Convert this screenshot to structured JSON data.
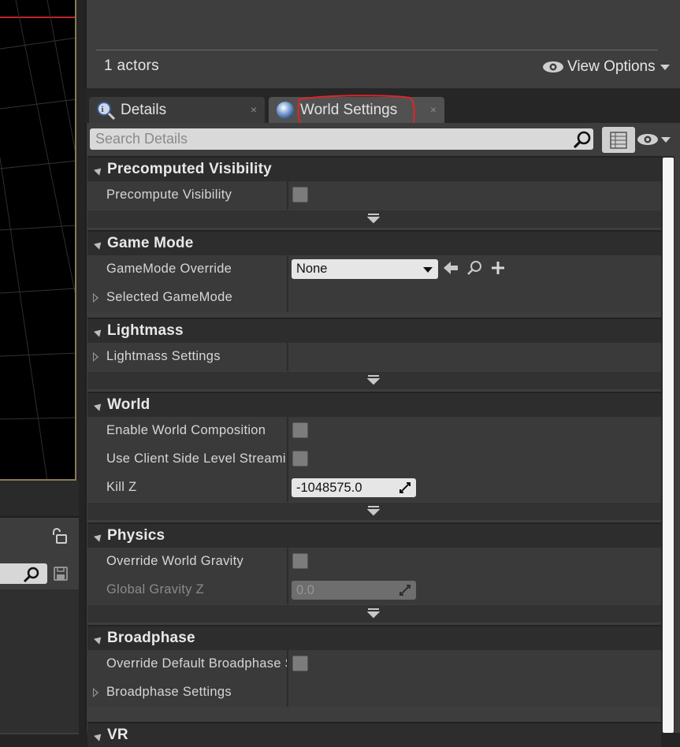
{
  "outliner": {
    "actors_count": "1 actors",
    "view_options_label": "View Options"
  },
  "tabs": [
    {
      "label": "Details",
      "icon": "magnifier-details-icon",
      "close": "×"
    },
    {
      "label": "World Settings",
      "icon": "globe-icon",
      "close": "×"
    }
  ],
  "search": {
    "placeholder": "Search Details"
  },
  "categories": {
    "precomputed_visibility": {
      "title": "Precomputed Visibility",
      "props": [
        {
          "label": "Precompute Visibility",
          "type": "checkbox",
          "checked": false
        }
      ]
    },
    "game_mode": {
      "title": "Game Mode",
      "props": [
        {
          "label": "GameMode Override",
          "type": "dropdown",
          "value": "None"
        },
        {
          "label": "Selected GameMode",
          "type": "expandable"
        }
      ]
    },
    "lightmass": {
      "title": "Lightmass",
      "props": [
        {
          "label": "Lightmass Settings",
          "type": "expandable"
        }
      ]
    },
    "world": {
      "title": "World",
      "props": [
        {
          "label": "Enable World Composition",
          "type": "checkbox",
          "checked": false
        },
        {
          "label": "Use Client Side Level Streaming Volumes",
          "type": "checkbox",
          "checked": false
        },
        {
          "label": "Kill Z",
          "type": "number",
          "value": "-1048575.0"
        }
      ]
    },
    "physics": {
      "title": "Physics",
      "props": [
        {
          "label": "Override World Gravity",
          "type": "checkbox",
          "checked": false
        },
        {
          "label": "Global Gravity Z",
          "type": "number",
          "value": "0.0",
          "disabled": true
        }
      ]
    },
    "broadphase": {
      "title": "Broadphase",
      "props": [
        {
          "label": "Override Default Broadphase Settings",
          "type": "checkbox",
          "checked": false
        },
        {
          "label": "Broadphase Settings",
          "type": "expandable"
        }
      ]
    },
    "next_partial": {
      "title": "VR"
    }
  },
  "colors": {
    "annotation": "#e0242b",
    "panel_bg": "#3d3d3d",
    "header_bg": "#2d2d2d"
  }
}
